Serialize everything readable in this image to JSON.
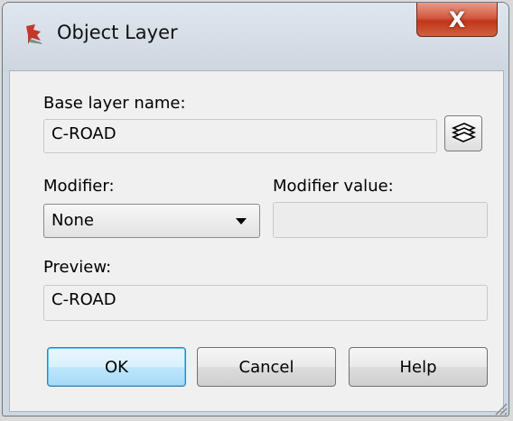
{
  "window": {
    "title": "Object Layer",
    "close_glyph": "X"
  },
  "base_layer": {
    "label": "Base layer name:",
    "value": "C-ROAD",
    "browse_icon": "layers-icon"
  },
  "modifier": {
    "label": "Modifier:",
    "selected": "None"
  },
  "modifier_value": {
    "label": "Modifier value:",
    "value": ""
  },
  "preview": {
    "label": "Preview:",
    "value": "C-ROAD"
  },
  "buttons": {
    "ok": "OK",
    "cancel": "Cancel",
    "help": "Help"
  }
}
